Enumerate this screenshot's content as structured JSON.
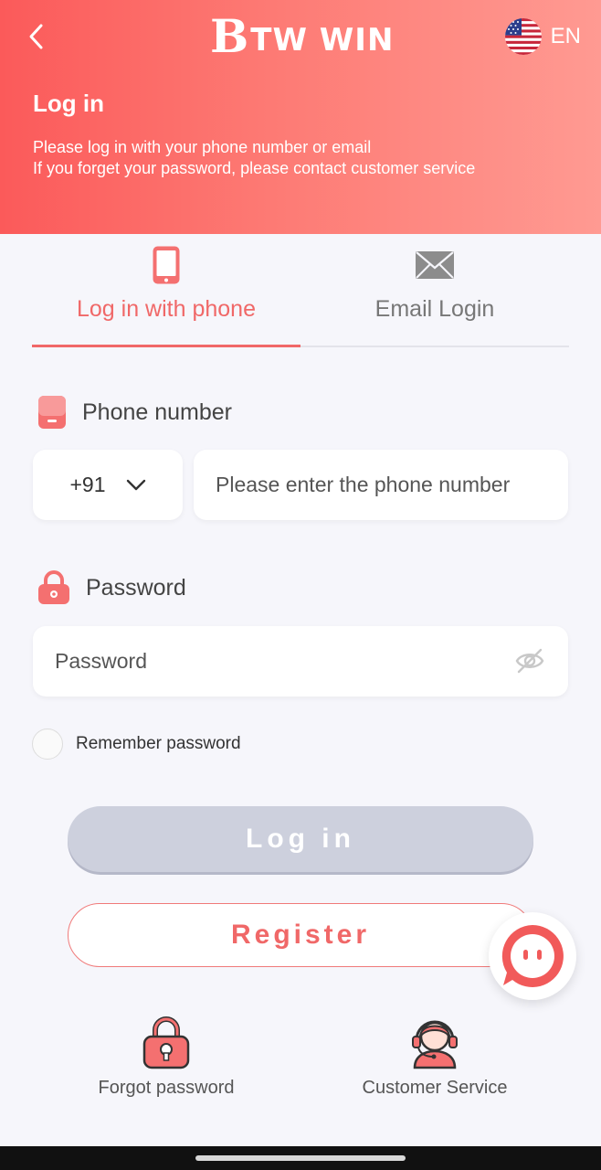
{
  "header": {
    "brand_mark": "B",
    "brand_text": "TW WIN",
    "language": "EN",
    "title": "Log in",
    "subtitle_line1": "Please log in with your phone number or email",
    "subtitle_line2": "If you forget your password, please contact customer service"
  },
  "tabs": [
    {
      "label": "Log in with phone",
      "icon": "phone-icon",
      "active": true
    },
    {
      "label": "Email Login",
      "icon": "envelope-icon",
      "active": false
    }
  ],
  "phone": {
    "label": "Phone number",
    "country_code": "+91",
    "placeholder": "Please enter the phone number"
  },
  "password": {
    "label": "Password",
    "placeholder": "Password"
  },
  "remember_label": "Remember password",
  "buttons": {
    "login": "Log in",
    "register": "Register"
  },
  "footer_links": {
    "forgot": "Forgot password",
    "service": "Customer Service"
  },
  "colors": {
    "accent": "#f06868",
    "header_start": "#fb5a5a",
    "header_end": "#ff9a92",
    "disabled_button": "#cdd0dd",
    "background": "#f6f6fb"
  }
}
